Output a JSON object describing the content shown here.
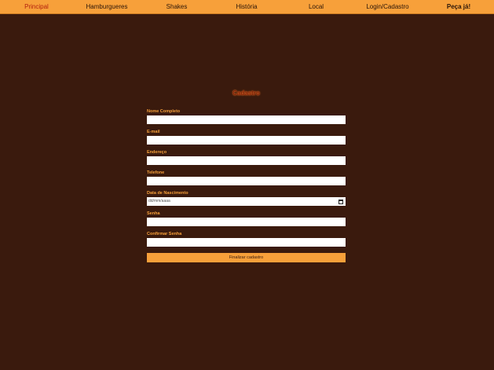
{
  "nav": {
    "items": [
      {
        "label": "Principal"
      },
      {
        "label": "Hamburgueres"
      },
      {
        "label": "Shakes"
      },
      {
        "label": "História"
      },
      {
        "label": "Local"
      },
      {
        "label": "Login/Cadastro"
      },
      {
        "label": "Peça já!"
      }
    ]
  },
  "form": {
    "title": "Cadastro",
    "fields": {
      "name": {
        "label": "Nome Completo"
      },
      "email": {
        "label": "E-mail"
      },
      "address": {
        "label": "Endereço"
      },
      "phone": {
        "label": "Telefone"
      },
      "birthdate": {
        "label": "Data de Nascimento",
        "placeholder": "dd/mm/aaaa"
      },
      "password": {
        "label": "Senha"
      },
      "confirm_password": {
        "label": "Confirmar Senha"
      }
    },
    "submit_label": "Finalizar cadastro"
  },
  "colors": {
    "background": "#3a1a0d",
    "accent": "#f7a03a",
    "active_nav": "#b3200e"
  }
}
